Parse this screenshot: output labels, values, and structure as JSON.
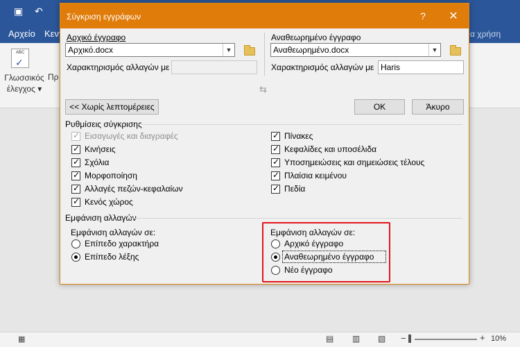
{
  "word": {
    "menu": {
      "file": "Αρχείο",
      "home": "Κεντ"
    },
    "tell_me": "α χρήση",
    "ribbon": {
      "spell_label": "Γλωσσικός έλεγχος",
      "spell_icon_text": "ABC",
      "pr": "Πρ"
    },
    "status": {
      "zoom": "10%"
    }
  },
  "dialog": {
    "title": "Σύγκριση εγγράφων",
    "help": "?",
    "close": "✕",
    "original": {
      "label": "Αρχικό έγγραφο",
      "value": "Αρχικό.docx",
      "changes_label": "Χαρακτηρισμός αλλαγών με",
      "changes_value": ""
    },
    "revised": {
      "label": "Αναθεωρημένο έγγραφο",
      "value": "Αναθεωρημένο.docx",
      "changes_label": "Χαρακτηρισμός αλλαγών με",
      "changes_value": "Haris"
    },
    "buttons": {
      "less": "<< Χωρίς λεπτομέρειες",
      "ok": "OK",
      "cancel": "Άκυρο"
    },
    "comparison_settings": {
      "title": "Ρυθμίσεις σύγκρισης",
      "left": [
        {
          "label": "Εισαγωγές και διαγραφές",
          "checked": true,
          "disabled": true
        },
        {
          "label": "Κινήσεις",
          "checked": true
        },
        {
          "label": "Σχόλια",
          "checked": true
        },
        {
          "label": "Μορφοποίηση",
          "checked": true
        },
        {
          "label": "Αλλαγές πεζών-κεφαλαίων",
          "checked": true
        },
        {
          "label": "Κενός χώρος",
          "checked": true
        }
      ],
      "right": [
        {
          "label": "Πίνακες",
          "checked": true
        },
        {
          "label": "Κεφαλίδες και υποσέλιδα",
          "checked": true
        },
        {
          "label": "Υποσημειώσεις και σημειώσεις τέλους",
          "checked": true
        },
        {
          "label": "Πλαίσια κειμένου",
          "checked": true
        },
        {
          "label": "Πεδία",
          "checked": true
        }
      ]
    },
    "show_changes": {
      "title": "Εμφάνιση αλλαγών",
      "level": {
        "label": "Εμφάνιση αλλαγών σε:",
        "options": [
          {
            "label": "Επίπεδο χαρακτήρα",
            "selected": false
          },
          {
            "label": "Επίπεδο λέξης",
            "selected": true
          }
        ]
      },
      "target": {
        "label": "Εμφάνιση αλλαγών σε:",
        "options": [
          {
            "label": "Αρχικό έγγραφο",
            "selected": false
          },
          {
            "label": "Αναθεωρημένο έγγραφο",
            "selected": true
          },
          {
            "label": "Νέο έγγραφο",
            "selected": false
          }
        ]
      }
    }
  },
  "colors": {
    "word_blue": "#2b579a",
    "dialog_title": "#e07c0a",
    "highlight": "#e4131b"
  }
}
